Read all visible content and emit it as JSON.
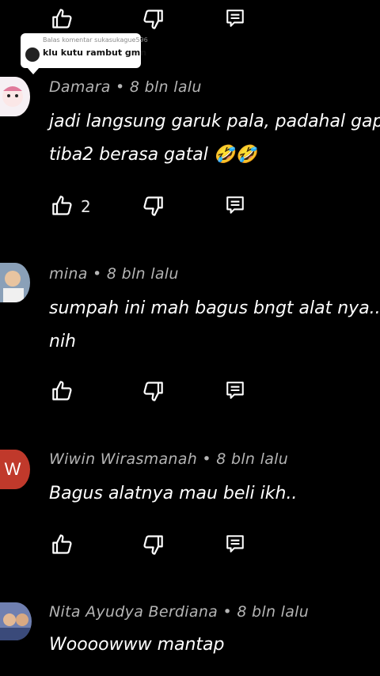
{
  "reply_popup": {
    "label": "Balas komentar sukasukague596",
    "text": "klu kutu rambut gmn"
  },
  "comments": [
    {
      "author": "Damara",
      "time": "8 bln lalu",
      "line1": "jadi langsung garuk pala, padahal gap",
      "line2": "tiba2 berasa gatal 🤣🤣",
      "likes": "2"
    },
    {
      "author": "mina",
      "time": "8 bln lalu",
      "line1": "sumpah ini mah bagus bngt alat nya..bl",
      "line2": "nih"
    },
    {
      "author": "Wiwin Wirasmanah",
      "time": "8 bln lalu",
      "line1": "Bagus alatnya mau beli ikh..",
      "avatar_letter": "W",
      "avatar_color": "#c0392b"
    },
    {
      "author": "Nita Ayudya Berdiana",
      "time": "8 bln lalu",
      "line1": "Woooowww mantap"
    }
  ],
  "separator": "•"
}
